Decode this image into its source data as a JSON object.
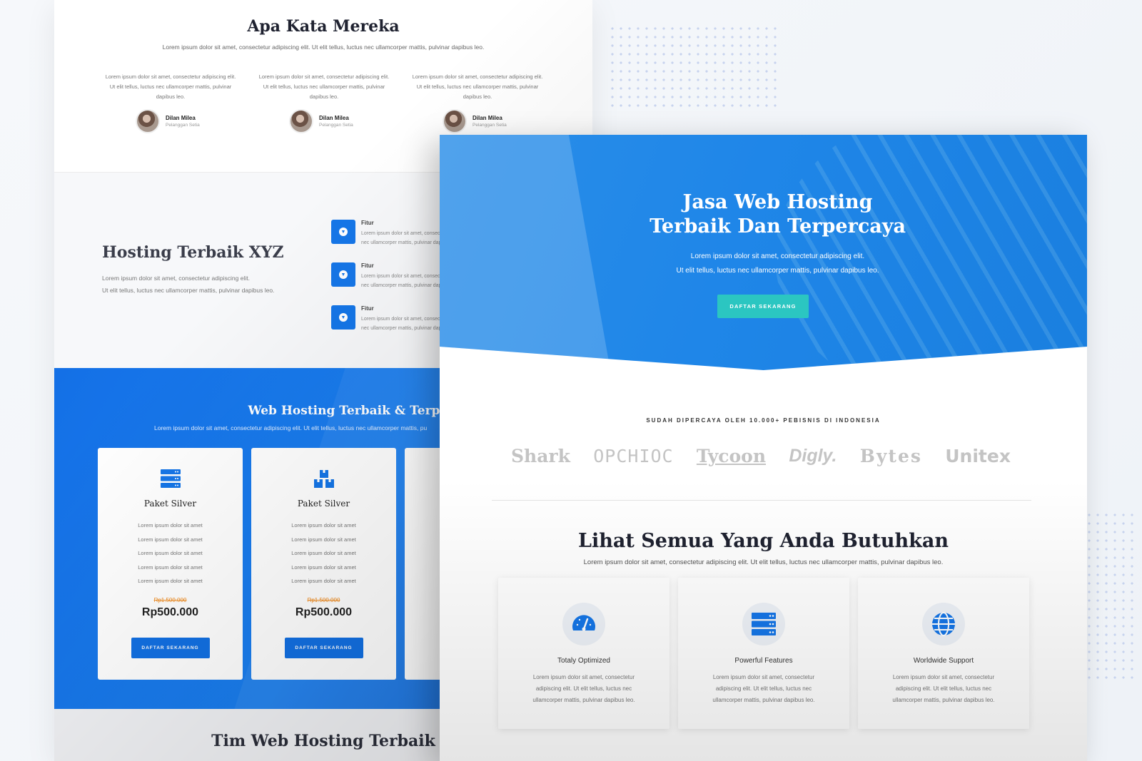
{
  "testimonials": {
    "title": "Apa Kata Mereka",
    "subtitle": "Lorem ipsum dolor sit amet, consectetur adipiscing elit. Ut elit tellus, luctus nec ullamcorper mattis, pulvinar dapibus leo.",
    "items": [
      {
        "quote": "Lorem ipsum dolor sit amet, consectetur adipiscing elit. Ut elit tellus, luctus nec ullamcorper mattis, pulvinar dapibus leo.",
        "name": "Dilan Milea",
        "role": "Pelanggan Setia"
      },
      {
        "quote": "Lorem ipsum dolor sit amet, consectetur adipiscing elit. Ut elit tellus, luctus nec ullamcorper mattis, pulvinar dapibus leo.",
        "name": "Dilan Milea",
        "role": "Pelanggan Setia"
      },
      {
        "quote": "Lorem ipsum dolor sit amet, consectetur adipiscing elit. Ut elit tellus, luctus nec ullamcorper mattis, pulvinar dapibus leo.",
        "name": "Dilan Milea",
        "role": "Pelanggan Setia"
      }
    ]
  },
  "about": {
    "title": "Hosting Terbaik XYZ",
    "description": "Lorem ipsum dolor sit amet, consectetur adipiscing elit.\nUt elit tellus, luctus nec ullamcorper mattis, pulvinar dapibus leo.",
    "features": [
      {
        "name": "Fitur",
        "text": "Lorem ipsum dolor sit amet, consectetur adipiscing elit. Ut elit tellus, luctus nec ullamcorper mattis, pulvinar dapibus leo."
      },
      {
        "name": "Fitur",
        "text": "Lorem ipsum dolor sit amet, consectetur adipiscing elit. Ut elit tellus, luctus nec ullamcorper mattis, pulvinar dapibus leo."
      },
      {
        "name": "Fitur",
        "text": "Lorem ipsum dolor sit amet, consectetur adipiscing elit. Ut elit tellus, luctus nec ullamcorper mattis, pulvinar dapibus leo."
      }
    ]
  },
  "pricing": {
    "title": "Web Hosting Terbaik & Terpercaya",
    "subtitle": "Lorem ipsum dolor sit amet, consectetur adipiscing elit. Ut elit tellus, luctus nec ullamcorper mattis, pu",
    "cards": [
      {
        "icon": "server-stack-icon",
        "name": "Paket Silver",
        "features": [
          "Lorem ipsum dolor sit amet",
          "Lorem ipsum dolor sit amet",
          "Lorem ipsum dolor sit amet",
          "Lorem ipsum dolor sit amet",
          "Lorem ipsum dolor sit amet"
        ],
        "old_price": "Rp1.500.000",
        "price": "Rp500.000",
        "button": "DAFTAR SEKARANG"
      },
      {
        "icon": "boxes-icon",
        "name": "Paket Silver",
        "features": [
          "Lorem ipsum dolor sit amet",
          "Lorem ipsum dolor sit amet",
          "Lorem ipsum dolor sit amet",
          "Lorem ipsum dolor sit amet",
          "Lorem ipsum dolor sit amet"
        ],
        "old_price": "Rp1.500.000",
        "price": "Rp500.000",
        "button": "DAFTAR SEKARANG"
      }
    ]
  },
  "team": {
    "title": "Tim Web Hosting Terbaik"
  },
  "hero": {
    "title_line1": "Jasa Web Hosting",
    "title_line2": "Terbaik Dan Terpercaya",
    "subtitle_line1": "Lorem ipsum dolor sit amet, consectetur adipiscing elit.",
    "subtitle_line2": "Ut elit tellus, luctus nec ullamcorper mattis, pulvinar dapibus leo.",
    "button": "DAFTAR SEKARANG"
  },
  "trust": {
    "label": "SUDAH DIPERCAYA OLEH 10.000+ PEBISNIS DI INDONESIA",
    "logos": [
      "Shark",
      "OPCHIOC",
      "Tycoon",
      "Digly.",
      "Bytes",
      "Unitex"
    ]
  },
  "services": {
    "title": "Lihat Semua Yang Anda Butuhkan",
    "subtitle": "Lorem ipsum dolor sit amet, consectetur adipiscing elit. Ut elit tellus, luctus nec ullamcorper mattis, pulvinar dapibus leo.",
    "items": [
      {
        "icon": "speedometer-icon",
        "name": "Totaly Optimized",
        "text": "Lorem ipsum dolor sit amet, consectetur adipiscing elit. Ut elit tellus, luctus nec ullamcorper mattis, pulvinar dapibus leo."
      },
      {
        "icon": "server-stack-icon",
        "name": "Powerful Features",
        "text": "Lorem ipsum dolor sit amet, consectetur adipiscing elit. Ut elit tellus, luctus nec ullamcorper mattis, pulvinar dapibus leo."
      },
      {
        "icon": "globe-icon",
        "name": "Worldwide Support",
        "text": "Lorem ipsum dolor sit amet, consectetur adipiscing elit. Ut elit tellus, luctus nec ullamcorper mattis, pulvinar dapibus leo."
      }
    ]
  },
  "colors": {
    "primary": "#1576e8",
    "accent": "#2bc6c1",
    "price_old": "#f08a1c"
  }
}
